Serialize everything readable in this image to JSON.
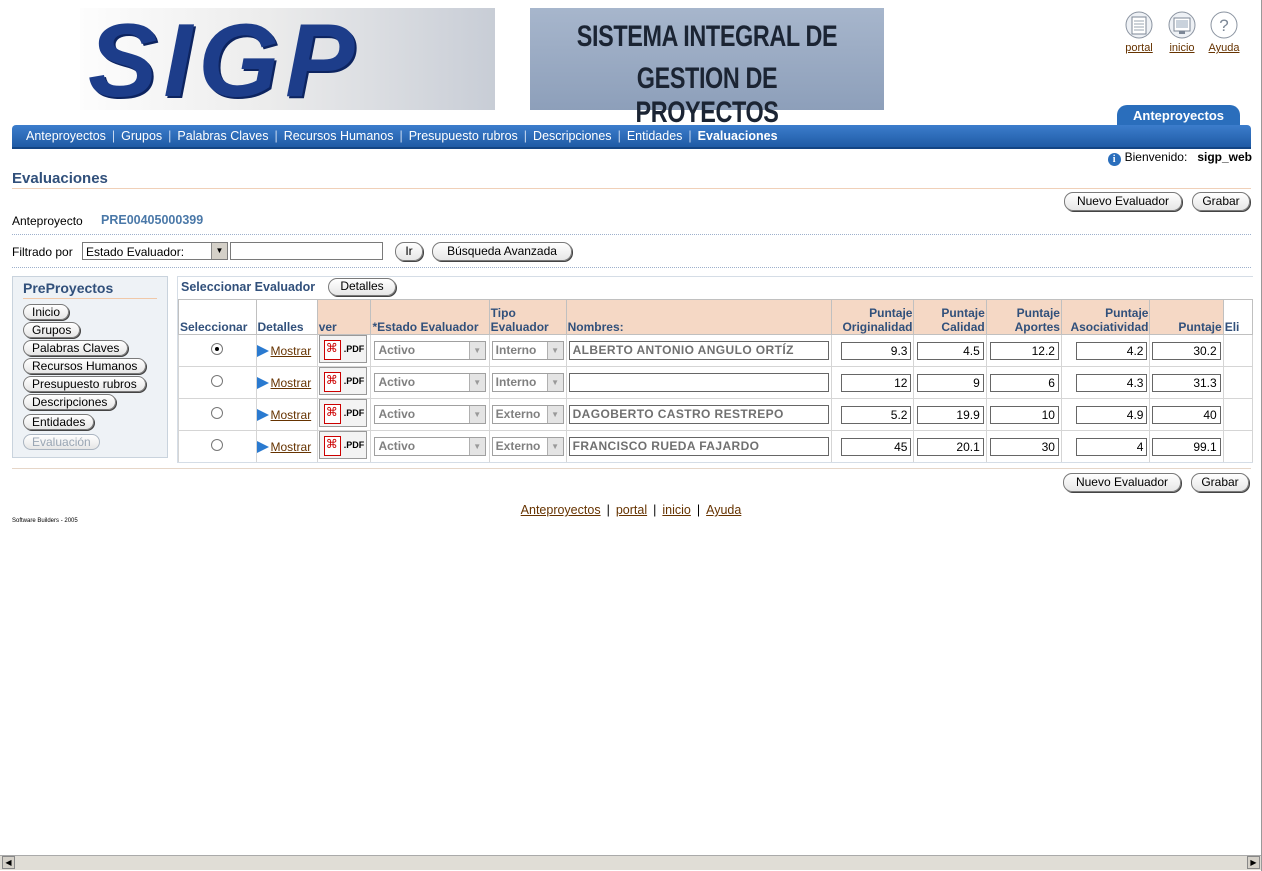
{
  "header": {
    "logo_text": "SIGP",
    "logo_caption_line1": "SISTEMA INTEGRAL DE",
    "logo_caption_line2": "GESTION DE PROYECTOS",
    "global_links": [
      {
        "label": "portal",
        "icon": "portal-icon"
      },
      {
        "label": "inicio",
        "icon": "home-icon"
      },
      {
        "label": "Ayuda",
        "icon": "help-icon"
      }
    ],
    "active_tab": "Anteproyectos"
  },
  "nav": {
    "items": [
      "Anteproyectos",
      "Grupos",
      "Palabras Claves",
      "Recursos Humanos",
      "Presupuesto rubros",
      "Descripciones",
      "Entidades",
      "Evaluaciones"
    ],
    "selected": "Evaluaciones"
  },
  "welcome": {
    "label": "Bienvenido:",
    "user": "sigp_web"
  },
  "page": {
    "title": "Evaluaciones",
    "new_button": "Nuevo Evaluador",
    "save_button": "Grabar",
    "anteproyecto_label": "Anteproyecto",
    "anteproyecto_value": "PRE00405000399"
  },
  "filter": {
    "label": "Filtrado por",
    "select_value": "Estado Evaluador:",
    "input_value": "",
    "go_button": "Ir",
    "advanced_button": "Búsqueda Avanzada"
  },
  "side_panel": {
    "title": "PreProyectos",
    "buttons": [
      "Inicio",
      "Grupos",
      "Palabras Claves",
      "Recursos Humanos",
      "Presupuesto rubros",
      "Descripciones",
      "Entidades",
      "Evaluación"
    ],
    "disabled_index": 7
  },
  "table": {
    "caption": "Seleccionar Evaluador",
    "details_button": "Detalles",
    "headers": {
      "select": "Seleccionar",
      "details": "Detalles",
      "ver": "ver",
      "estado": "*Estado Evaluador",
      "tipo_l1": "Tipo",
      "tipo_l2": "Evaluador",
      "nombres": "Nombres:",
      "orig_l1": "Puntaje",
      "orig_l2": "Originalidad",
      "cal_l1": "Puntaje",
      "cal_l2": "Calidad",
      "apo_l1": "Puntaje",
      "apo_l2": "Aportes",
      "aso_l1": "Puntaje",
      "aso_l2": "Asociatividad",
      "puntaje": "Puntaje",
      "eliminar": "Eli"
    },
    "link_text": "Mostrar",
    "pdf_text": ".PDF",
    "rows": [
      {
        "selected": true,
        "estado": "Activo",
        "tipo": "Interno",
        "nombre": "ALBERTO ANTONIO ANGULO ORTÍZ",
        "originalidad": "9.3",
        "calidad": "4.5",
        "aportes": "12.2",
        "asociatividad": "4.2",
        "puntaje": "30.2"
      },
      {
        "selected": false,
        "estado": "Activo",
        "tipo": "Interno",
        "nombre": "",
        "originalidad": "12",
        "calidad": "9",
        "aportes": "6",
        "asociatividad": "4.3",
        "puntaje": "31.3"
      },
      {
        "selected": false,
        "estado": "Activo",
        "tipo": "Externo",
        "nombre": "DAGOBERTO CASTRO RESTREPO",
        "originalidad": "5.2",
        "calidad": "19.9",
        "aportes": "10",
        "asociatividad": "4.9",
        "puntaje": "40"
      },
      {
        "selected": false,
        "estado": "Activo",
        "tipo": "Externo",
        "nombre": "FRANCISCO RUEDA FAJARDO",
        "originalidad": "45",
        "calidad": "20.1",
        "aportes": "30",
        "asociatividad": "4",
        "puntaje": "99.1"
      }
    ]
  },
  "footer": {
    "links": [
      "Anteproyectos",
      "portal",
      "inicio",
      "Ayuda"
    ],
    "credit": "Software Builders - 2005"
  }
}
